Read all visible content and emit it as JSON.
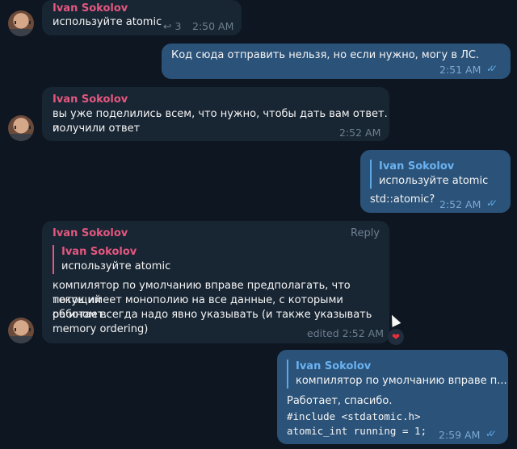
{
  "messages": {
    "m1": {
      "author": "Ivan Sokolov",
      "text": "используйте atomic",
      "reply_count": "3",
      "time": "2:50 AM",
      "reply_icon": "reply-arrow-icon"
    },
    "m2": {
      "text": "Код сюда отправить нельзя, но если нужно, могу в ЛС.",
      "time": "2:51 AM"
    },
    "m3": {
      "author": "Ivan Sokolov",
      "line1": "вы уже поделились всем, что нужно, чтобы дать вам ответ. и",
      "line2": "получили ответ",
      "time": "2:52 AM"
    },
    "m4": {
      "reply_author": "Ivan Sokolov",
      "reply_text": "используйте atomic",
      "text": "std::atomic?",
      "time": "2:52 AM"
    },
    "m5": {
      "author": "Ivan Sokolov",
      "reply_label": "Reply",
      "reply_author": "Ivan Sokolov",
      "reply_text": "используйте atomic",
      "lines": [
        "компилятор по умолчанию вправе предполагать, что текущий",
        "поток имеет монополию на все данные, с которыми работает.",
        "об ином всегда надо явно указывать (и также указывать",
        "memory ordering)"
      ],
      "time": "edited 2:52 AM",
      "reaction": "❤"
    },
    "m6": {
      "reply_author": "Ivan Sokolov",
      "reply_text": "компилятор по умолчанию вправе п...",
      "line1": "Работает, спасибо.",
      "code1": "#include <stdatomic.h>",
      "code2": "atomic_int running = 1;",
      "time": "2:59 AM"
    }
  },
  "colors": {
    "background": "#0e1621",
    "incoming": "#182533",
    "outgoing": "#2b5278",
    "author": "#e4577f",
    "accent": "#5ea8e6"
  }
}
